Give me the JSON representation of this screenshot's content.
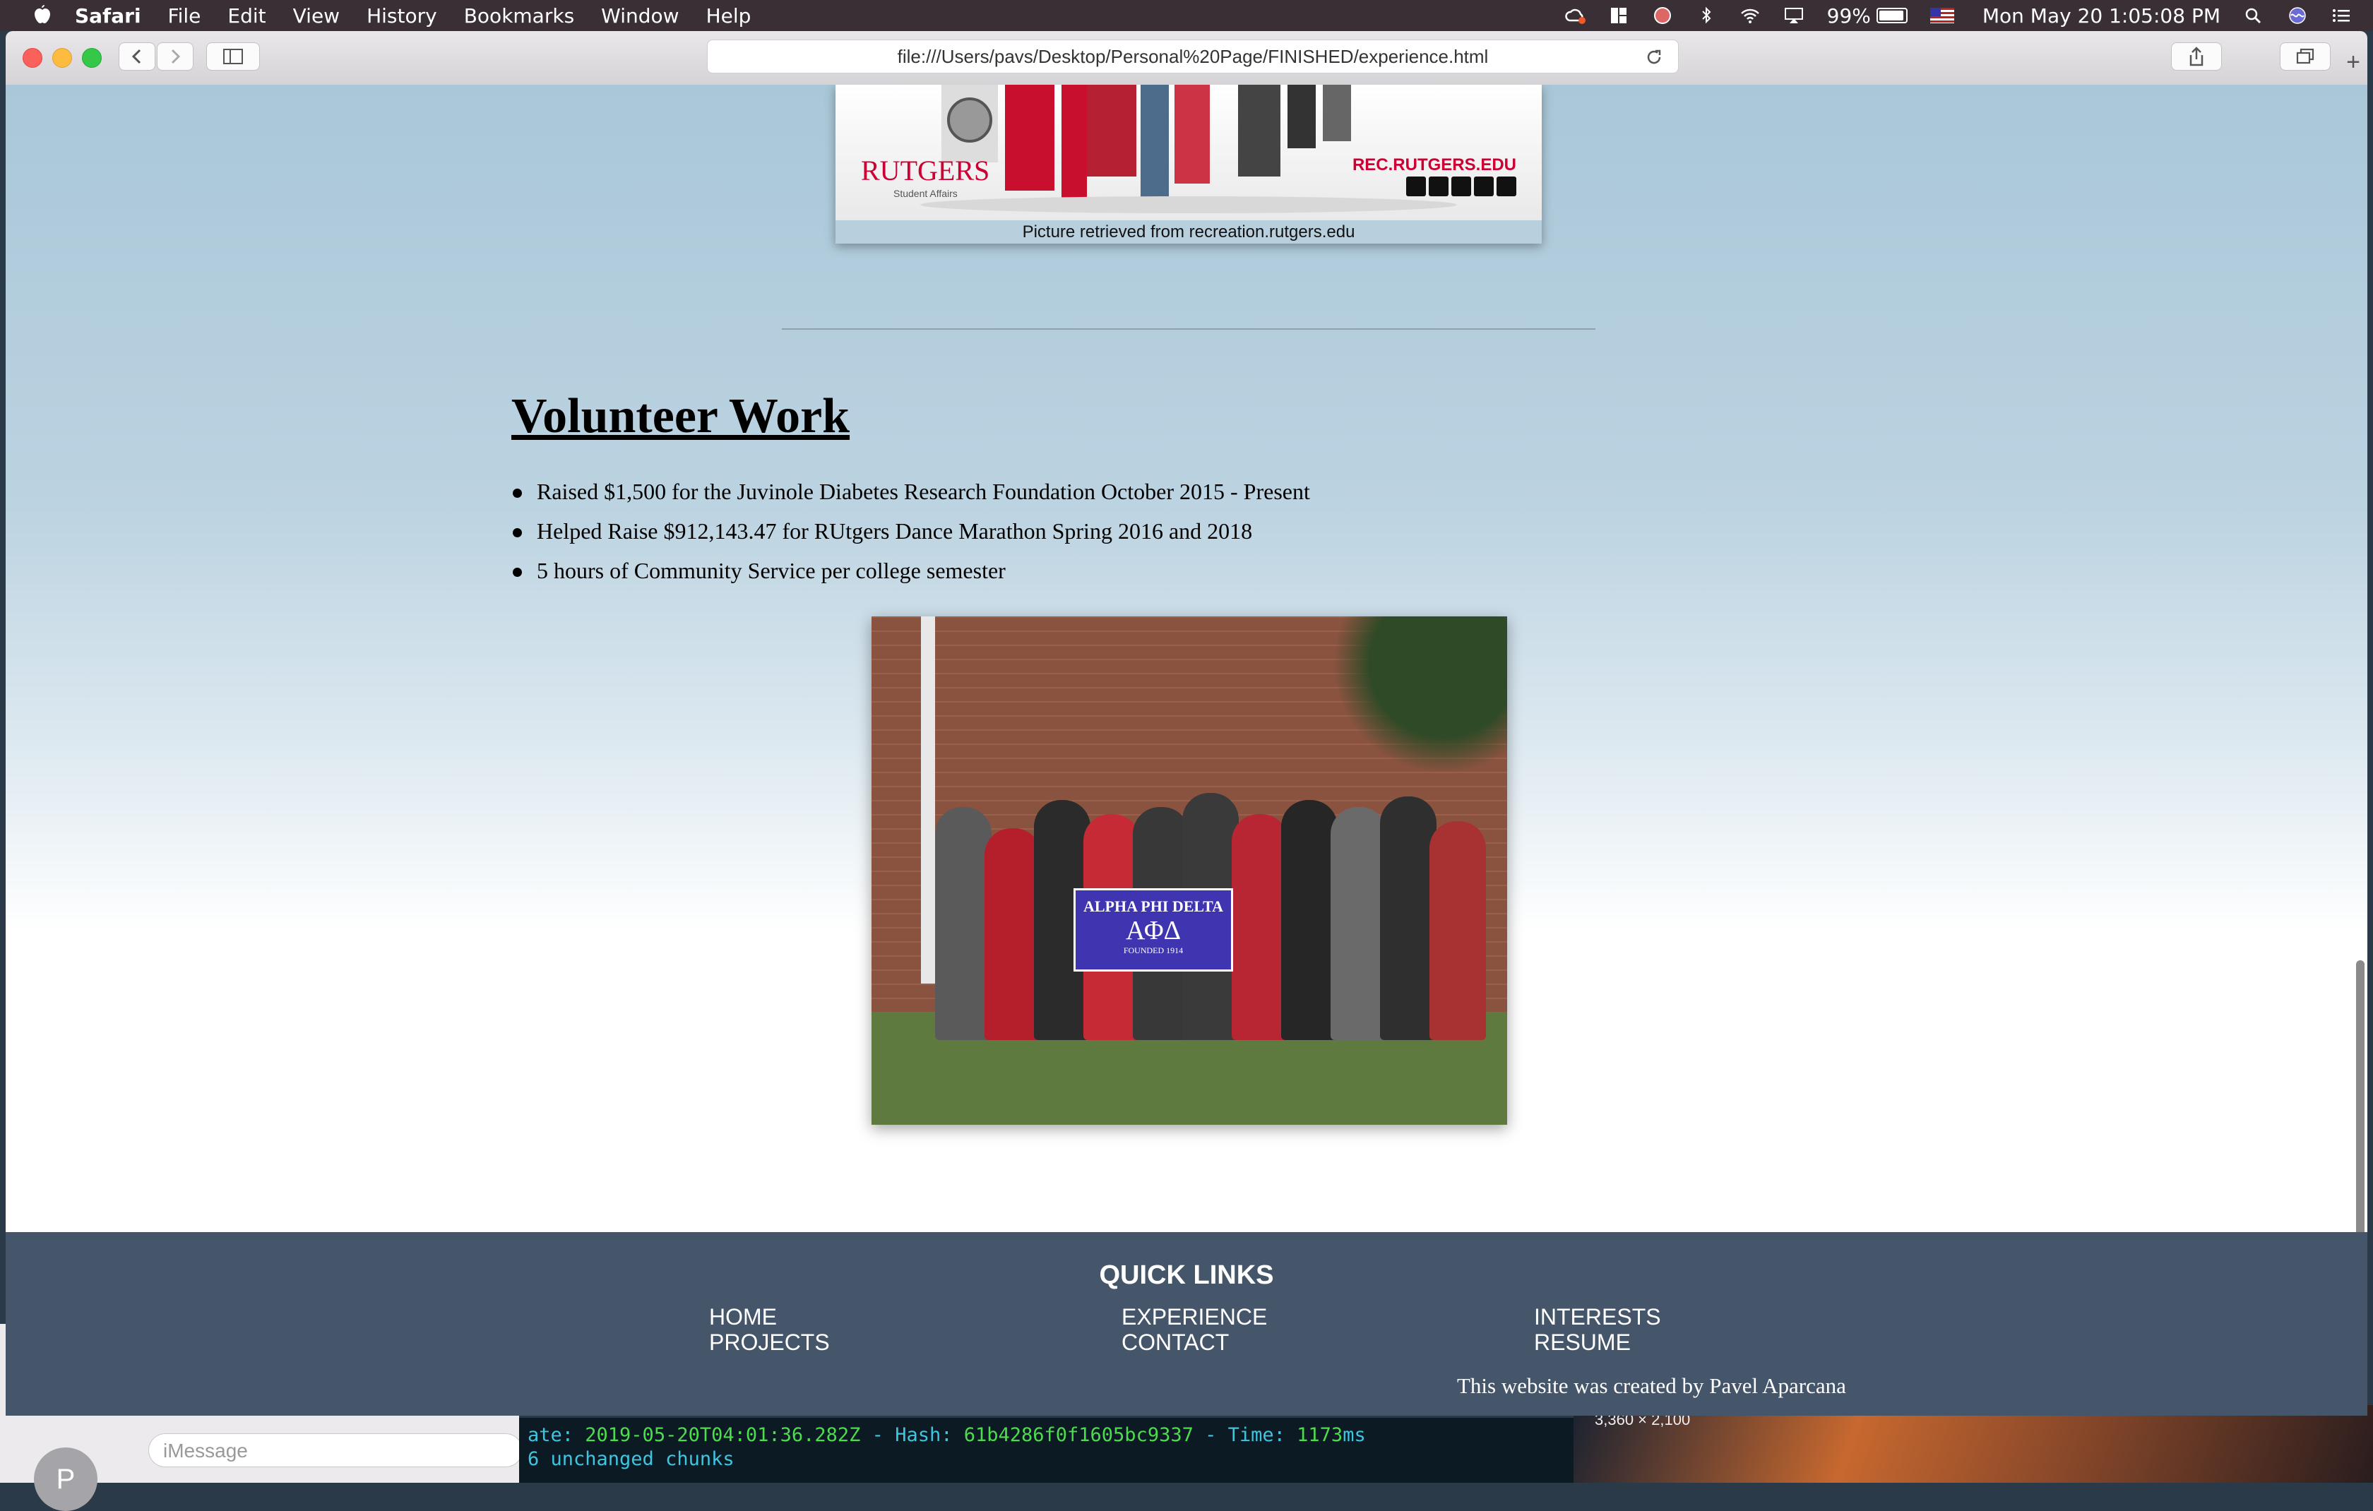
{
  "menubar": {
    "app": "Safari",
    "items": [
      "File",
      "Edit",
      "View",
      "History",
      "Bookmarks",
      "Window",
      "Help"
    ],
    "battery": "99%",
    "clock": "Mon May 20  1:05:08 PM"
  },
  "browser": {
    "url": "file:///Users/pavs/Desktop/Personal%20Page/FINISHED/experience.html"
  },
  "banner": {
    "logo": "RUTGERS",
    "logo_sub": "Student Affairs",
    "site": "REC.RUTGERS.EDU",
    "caption": "Picture retrieved from recreation.rutgers.edu"
  },
  "volunteer": {
    "title": "Volunteer Work",
    "items": [
      "Raised $1,500 for the Juvinole Diabetes Research Foundation October 2015 - Present",
      "Helped Raise $912,143.47 for RUtgers Dance Marathon Spring 2016 and 2018",
      "5 hours of Community Service per college semester"
    ],
    "photo_banner": {
      "line1": "ALPHA PHI DELTA",
      "line2": "ΑΦΔ",
      "line3": "FOUNDED 1914"
    }
  },
  "footer": {
    "heading": "QUICK LINKS",
    "links": {
      "home": "HOME",
      "projects": "PROJECTS",
      "experience": "EXPERIENCE",
      "contact": "CONTACT",
      "interests": "INTERESTS",
      "resume": "RESUME"
    },
    "credit": "This website was created by Pavel Aparcana"
  },
  "background": {
    "imessage_placeholder": "iMessage",
    "avatar_letter": "P",
    "terminal_line1_prefix": "ate: ",
    "terminal_line1_date": "2019-05-20T04:01:36.282Z",
    "terminal_line1_hash_label": " - Hash: ",
    "terminal_line1_hash": "61b4286f0f1605bc9337",
    "terminal_line1_time_label": " - Time: ",
    "terminal_line1_time": "1173",
    "terminal_line1_unit": "ms",
    "terminal_line2": "6 unchanged chunks",
    "desktop_dims": "3,360 × 2,100"
  },
  "colors": {
    "footer_bg": "#46566a",
    "rutgers_red": "#cc0033",
    "banner_purple": "#3f35b0"
  }
}
